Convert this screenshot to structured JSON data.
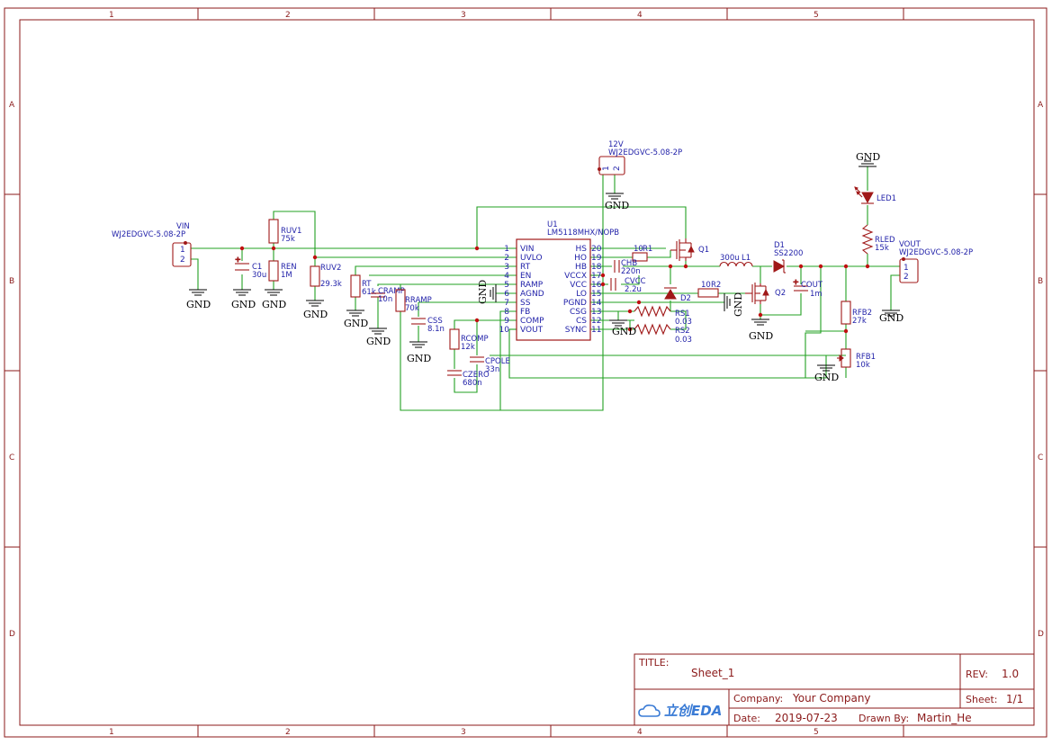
{
  "ruler": {
    "cols": [
      "1",
      "2",
      "3",
      "4",
      "5"
    ],
    "rows": [
      "A",
      "B",
      "C",
      "D"
    ]
  },
  "components": {
    "u1": {
      "ref": "U1",
      "part": "LM5118MHX/NOPB",
      "left_pins": [
        {
          "num": "1",
          "name": "VIN"
        },
        {
          "num": "2",
          "name": "UVLO"
        },
        {
          "num": "3",
          "name": "RT"
        },
        {
          "num": "4",
          "name": "EN"
        },
        {
          "num": "5",
          "name": "RAMP"
        },
        {
          "num": "6",
          "name": "AGND"
        },
        {
          "num": "7",
          "name": "SS"
        },
        {
          "num": "8",
          "name": "FB"
        },
        {
          "num": "9",
          "name": "COMP"
        },
        {
          "num": "10",
          "name": "VOUT"
        }
      ],
      "right_pins": [
        {
          "num": "20",
          "name": "HS"
        },
        {
          "num": "19",
          "name": "HO"
        },
        {
          "num": "18",
          "name": "HB"
        },
        {
          "num": "17",
          "name": "VCCX"
        },
        {
          "num": "16",
          "name": "VCC"
        },
        {
          "num": "15",
          "name": "LO"
        },
        {
          "num": "14",
          "name": "PGND"
        },
        {
          "num": "13",
          "name": "CSG"
        },
        {
          "num": "12",
          "name": "CS"
        },
        {
          "num": "11",
          "name": "SYNC"
        }
      ]
    },
    "vin": {
      "ref": "VIN",
      "part": "WJ2EDGVC-5.08-2P",
      "pin1": "1",
      "pin2": "2"
    },
    "j12v": {
      "ref": "12V",
      "part": "WJ2EDGVC-5.08-2P",
      "pin1": "1",
      "pin2": "2"
    },
    "vout": {
      "ref": "VOUT",
      "part": "WJ2EDGVC-5.08-2P",
      "pin1": "1",
      "pin2": "2"
    },
    "c1": {
      "ref": "C1",
      "value": "30u"
    },
    "ruv1": {
      "ref": "RUV1",
      "value": "75k"
    },
    "ren": {
      "ref": "REN",
      "value": "1M"
    },
    "ruv2": {
      "ref": "RUV2",
      "value": "29.3k"
    },
    "rt": {
      "ref": "RT",
      "value": "61k"
    },
    "cramp": {
      "ref": "CRAMP",
      "value": "10n"
    },
    "rramp": {
      "ref": "RRAMP",
      "value": "70k"
    },
    "css": {
      "ref": "CSS",
      "value": "8.1n"
    },
    "rcomp": {
      "ref": "RCOMP",
      "value": "12k"
    },
    "cpole": {
      "ref": "CPOLE",
      "value": "33n"
    },
    "czero": {
      "ref": "CZERO",
      "value": "680n"
    },
    "r1": {
      "ref": "R1",
      "value": "10"
    },
    "chb": {
      "ref": "CHB",
      "value": "220n"
    },
    "cvcc": {
      "ref": "CVCC",
      "value": "2.2u"
    },
    "q1": {
      "ref": "Q1"
    },
    "d2": {
      "ref": "D2"
    },
    "r2": {
      "ref": "R2",
      "value": "10"
    },
    "rs1": {
      "ref": "RS1",
      "value": "0.03"
    },
    "rs2": {
      "ref": "RS2",
      "value": "0.03"
    },
    "l1": {
      "ref": "L1",
      "value": "300u"
    },
    "q2": {
      "ref": "Q2"
    },
    "d1": {
      "ref": "D1",
      "part": "SS2200"
    },
    "cout": {
      "ref": "COUT",
      "value": "1m"
    },
    "led1": {
      "ref": "LED1"
    },
    "rled": {
      "ref": "RLED",
      "value": "15k"
    },
    "rfb2": {
      "ref": "RFB2",
      "value": "27k"
    },
    "rfb1": {
      "ref": "RFB1",
      "value": "10k"
    }
  },
  "gnd_label": "GND",
  "title_block": {
    "title_label": "TITLE:",
    "title": "Sheet_1",
    "rev_label": "REV:",
    "rev": "1.0",
    "company_label": "Company:",
    "company": "Your Company",
    "sheet_label": "Sheet:",
    "sheet": "1/1",
    "date_label": "Date:",
    "date": "2019-07-23",
    "drawn_label": "Drawn By:",
    "drawn_by": "Martin_He",
    "logo_text": "立创EDA"
  },
  "colors": {
    "frame": "#8b1a1a",
    "wire": "#22a022",
    "component": "#a01818",
    "label": "#1f1fa8",
    "logo": "#3a7bd5"
  }
}
